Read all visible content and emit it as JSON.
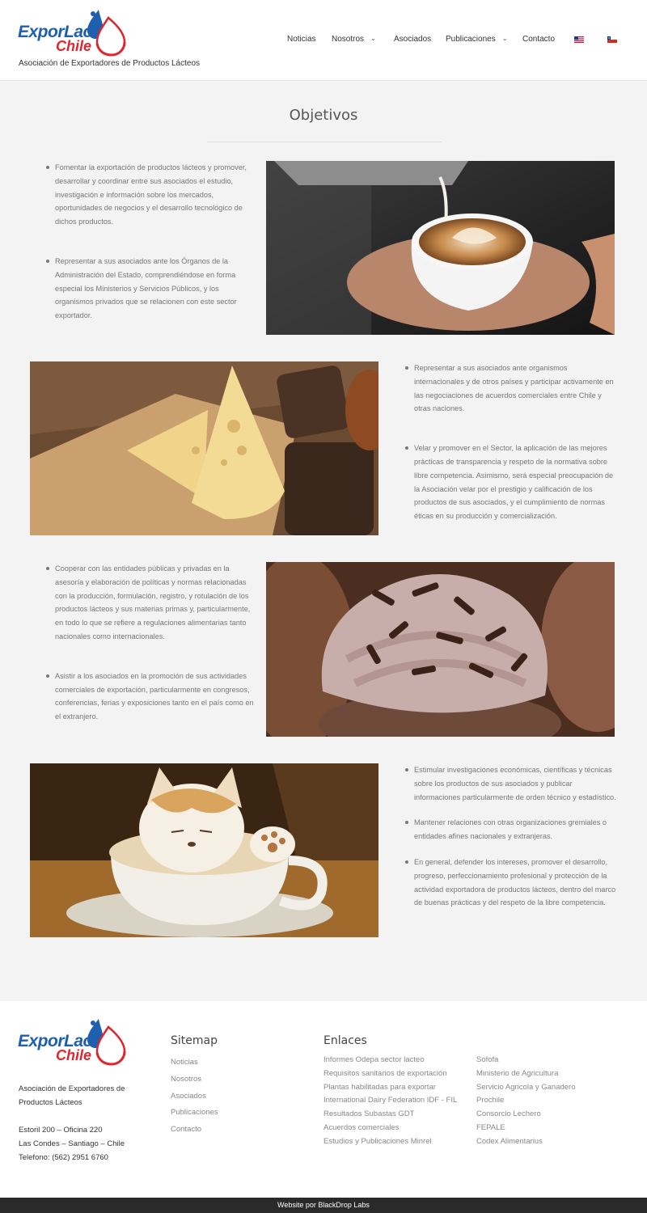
{
  "brand": {
    "name_line1": "ExporLac",
    "name_line2": "Chile",
    "tagline": "Asociación de Exportadores de Productos Lácteos",
    "primary_color": "#1f5fb0",
    "accent_color": "#e0262d"
  },
  "nav": {
    "items": [
      {
        "label": "Noticias",
        "has_dropdown": false
      },
      {
        "label": "Nosotros",
        "has_dropdown": true
      },
      {
        "label": "Asociados",
        "has_dropdown": false
      },
      {
        "label": "Publicaciones",
        "has_dropdown": true
      },
      {
        "label": "Contacto",
        "has_dropdown": false
      }
    ],
    "flags": [
      "us-flag-icon",
      "chile-flag-icon"
    ]
  },
  "main": {
    "title": "Objetivos",
    "rows": [
      {
        "image": "latte-art-cup-photo",
        "bullets": [
          "Fomentar la exportación de productos lácteos y promover, desarrollar y coordinar entre sus asociados el estudio, investigación e información sobre los mercados, oportunidades de negocios y el desarrollo tecnológico de dichos productos.",
          "Representar a sus asociados ante los Órganos de la Administración del Estado, comprendiéndose en forma especial los Ministerios y Servicios Públicos, y los organismos privados que se relacionen con este sector exportador."
        ]
      },
      {
        "image": "cheese-and-bread-photo",
        "bullets": [
          "Representar a sus asociados ante organismos internacionales y de otros países y participar activamente en las negociaciones de acuerdos comerciales entre Chile y otras naciones.",
          "Velar y promover en el Sector, la aplicación de las mejores prácticas de transparencia y respeto de la normativa sobre libre competencia. Asimismo, será especial preocupación de la Asociación velar por el prestigio y calificación de los productos de sus asociados, y el cumplimiento de normas éticas en su producción y comercialización."
        ]
      },
      {
        "image": "chocolate-cupcake-photo",
        "bullets": [
          "Cooperar con las entidades públicas y privadas en la asesoría y elaboración de políticas y normas relacionadas con la producción, formulación, registro, y rotulación de los productos lácteos y sus materias primas y, particularmente, en todo lo que se refiere a regulaciones alimentarias tanto nacionales como internacionales.",
          "Asistir a los asociados en la promoción de sus actividades comerciales de exportación, particularmente en congresos, conferencias, ferias y exposiciones tanto en el país como en el extranjero."
        ]
      },
      {
        "image": "dog-foam-coffee-photo",
        "bullets": [
          "Estimular investigaciones económicas, científicas y técnicas sobre los productos de sus asociados y publicar informaciones particularmente de orden técnico y estadístico.",
          "Mantener relaciones con otras organizaciones gremiales o entidades afines nacionales y extranjeras.",
          "En general, defender los intereses, promover el desarrollo, progreso, perfeccionamiento profesional y protección de la actividad exportadora de productos lácteos, dentro del marco de buenas prácticas y del respeto de la libre competencia."
        ]
      }
    ]
  },
  "footer": {
    "assoc_name": "Asociación de Exportadores de Productos Lácteos",
    "address_line1": "Estoril 200 – Oficina 220",
    "address_line2": "Las Condes – Santiago – Chile",
    "phone": "Telefono: (562) 2951 6760",
    "sitemap_title": "Sitemap",
    "sitemap": [
      "Noticias",
      "Nosotros",
      "Asociados",
      "Publicaciones",
      "Contacto"
    ],
    "links_title": "Enlaces",
    "links_col1": [
      "Informes Odepa sector lacteo",
      "Requisitos sanitarios de exportación",
      "Plantas habilitadas para exportar",
      "International Dairy Federation IDF - FIL",
      "Resultados Subastas GDT",
      "Acuerdos comerciales",
      "Estudios y Publicaciones Minrel"
    ],
    "links_col2": [
      "Sofofa",
      "Ministerio de Agricultura",
      "Servicio Agricola y Ganadero",
      "Prochile",
      "Consorcio Lechero",
      "FEPALE",
      "Codex Alimentarius"
    ],
    "credit": "Website por BlackDrop Labs"
  }
}
